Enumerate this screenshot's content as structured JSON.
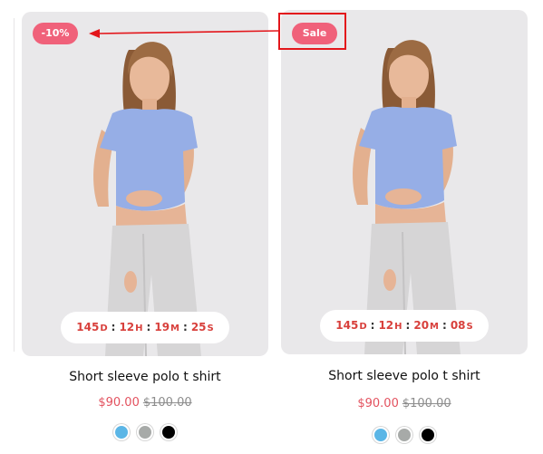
{
  "colors": {
    "badge": "#f0617a",
    "price": "#e3525f",
    "countdown_text": "#d8403c",
    "annotation": "#e3161b"
  },
  "products": [
    {
      "badge": "-10%",
      "title": "Short sleeve polo t shirt",
      "price": "$90.00",
      "compare_price": "$100.00",
      "countdown": {
        "days": "145",
        "days_unit": "D",
        "hours": "12",
        "hours_unit": "H",
        "minutes": "19",
        "minutes_unit": "M",
        "seconds": "25",
        "seconds_unit": "S",
        "separator": ":"
      },
      "swatches": [
        {
          "name": "blue",
          "color": "#5bb6e6"
        },
        {
          "name": "gray",
          "color": "#a7aaa8"
        },
        {
          "name": "black",
          "color": "#000000"
        }
      ]
    },
    {
      "badge": "Sale",
      "title": "Short sleeve polo t shirt",
      "price": "$90.00",
      "compare_price": "$100.00",
      "countdown": {
        "days": "145",
        "days_unit": "D",
        "hours": "12",
        "hours_unit": "H",
        "minutes": "20",
        "minutes_unit": "M",
        "seconds": "08",
        "seconds_unit": "S",
        "separator": ":"
      },
      "swatches": [
        {
          "name": "blue",
          "color": "#5bb6e6"
        },
        {
          "name": "gray",
          "color": "#a7aaa8"
        },
        {
          "name": "black",
          "color": "#000000"
        }
      ]
    }
  ]
}
